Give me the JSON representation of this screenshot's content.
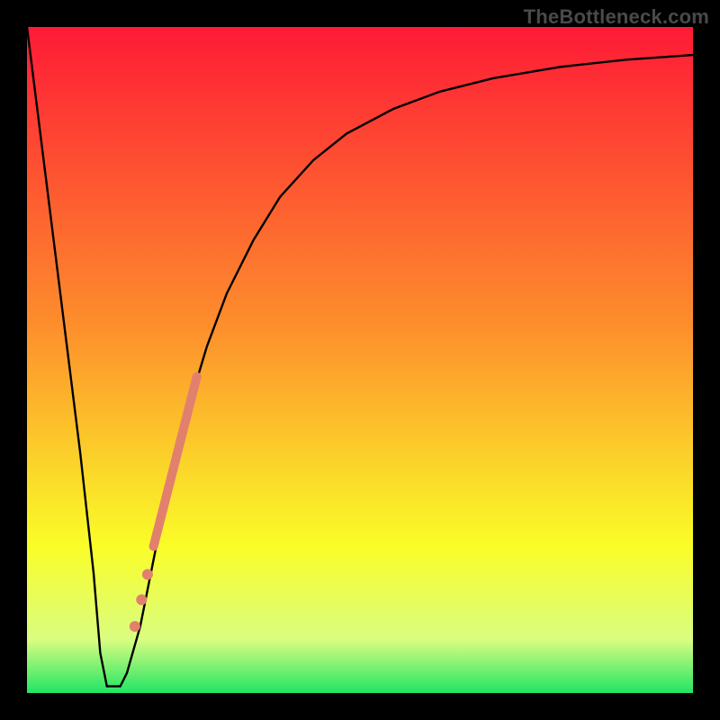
{
  "watermark": "TheBottleneck.com",
  "chart_data": {
    "type": "line",
    "title": "",
    "xlabel": "",
    "ylabel": "",
    "xlim": [
      0,
      100
    ],
    "ylim": [
      0,
      100
    ],
    "grid": false,
    "legend": false,
    "background_gradient": {
      "top": "#fe1a36",
      "mid_upper": "#fd8f2c",
      "mid": "#fafd28",
      "mid_lower": "#d9fd81",
      "bottom": "#22e564"
    },
    "series": [
      {
        "name": "bottleneck-curve",
        "type": "line",
        "color": "#000000",
        "stroke_width": 2.4,
        "x": [
          0,
          2,
          4,
          6,
          8,
          10,
          11,
          12,
          13,
          14,
          15,
          17,
          19,
          21,
          24,
          27,
          30,
          34,
          38,
          43,
          48,
          55,
          62,
          70,
          80,
          90,
          100
        ],
        "y": [
          100,
          84,
          68,
          52,
          36,
          18,
          6,
          1,
          1,
          1,
          3,
          10,
          20,
          30,
          42,
          52,
          60,
          68,
          74.5,
          80,
          84,
          87.7,
          90.3,
          92.3,
          94,
          95.1,
          95.8
        ]
      },
      {
        "name": "highlight-segment",
        "type": "line",
        "color": "#e2806e",
        "stroke_width": 10,
        "linecap": "round",
        "x": [
          19.0,
          25.5
        ],
        "y": [
          22.0,
          47.5
        ]
      },
      {
        "name": "highlight-dots",
        "type": "scatter",
        "color": "#e2806e",
        "radius": 6,
        "x": [
          16.2,
          17.2,
          18.1
        ],
        "y": [
          10.0,
          14.0,
          17.8
        ]
      }
    ]
  }
}
